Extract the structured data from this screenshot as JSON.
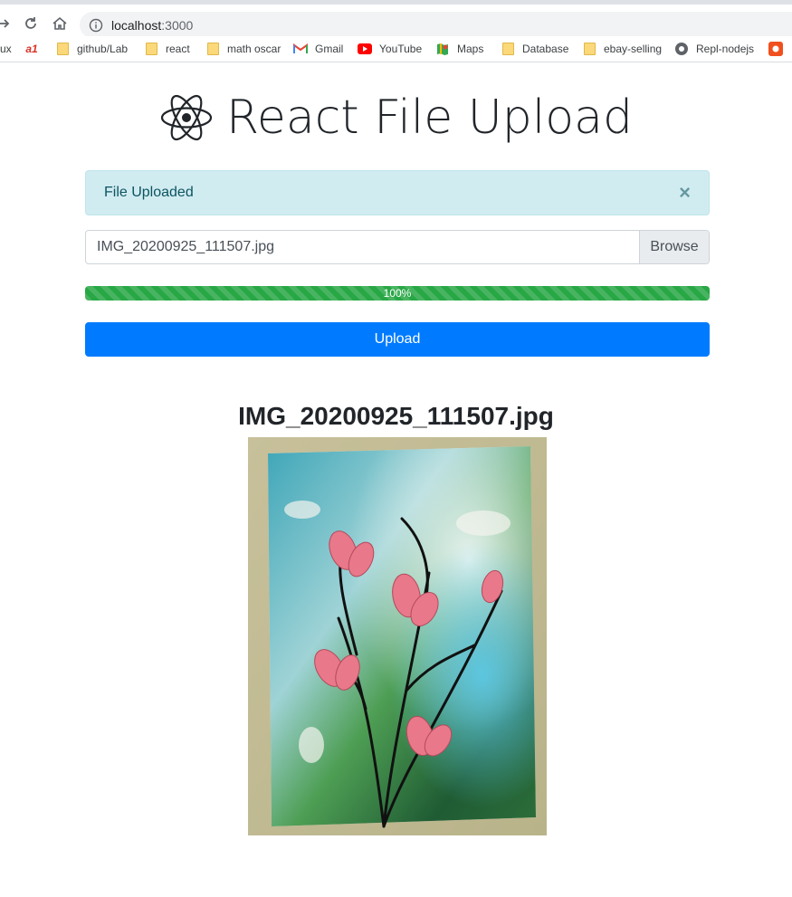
{
  "browser": {
    "url_host": "localhost",
    "url_port": ":3000",
    "bookmarks": [
      {
        "label": "ux",
        "icon": "partial-icon"
      },
      {
        "label": "",
        "icon": "ai-red-icon"
      },
      {
        "label": "github/Lab",
        "icon": "folder-icon"
      },
      {
        "label": "react",
        "icon": "folder-icon"
      },
      {
        "label": "math oscar",
        "icon": "folder-icon"
      },
      {
        "label": "Gmail",
        "icon": "gmail-icon"
      },
      {
        "label": "YouTube",
        "icon": "youtube-icon"
      },
      {
        "label": "Maps",
        "icon": "maps-icon"
      },
      {
        "label": "Database",
        "icon": "folder-icon"
      },
      {
        "label": "ebay-selling",
        "icon": "folder-icon"
      },
      {
        "label": "Repl-nodejs",
        "icon": "repl-icon"
      },
      {
        "label": "",
        "icon": "red-app-icon"
      }
    ]
  },
  "page": {
    "title": "React File Upload",
    "alert": {
      "message": "File Uploaded",
      "close": "×"
    },
    "file_input": {
      "filename": "IMG_20200925_111507.jpg",
      "browse_label": "Browse"
    },
    "progress": {
      "percent": 100,
      "label": "100%"
    },
    "upload_label": "Upload",
    "uploaded": {
      "filename": "IMG_20200925_111507.jpg",
      "image": "flower-painting-photo"
    }
  },
  "colors": {
    "alert_bg": "#d1ecf1",
    "alert_text": "#0c5460",
    "progress": "#28a745",
    "primary": "#007bff"
  }
}
